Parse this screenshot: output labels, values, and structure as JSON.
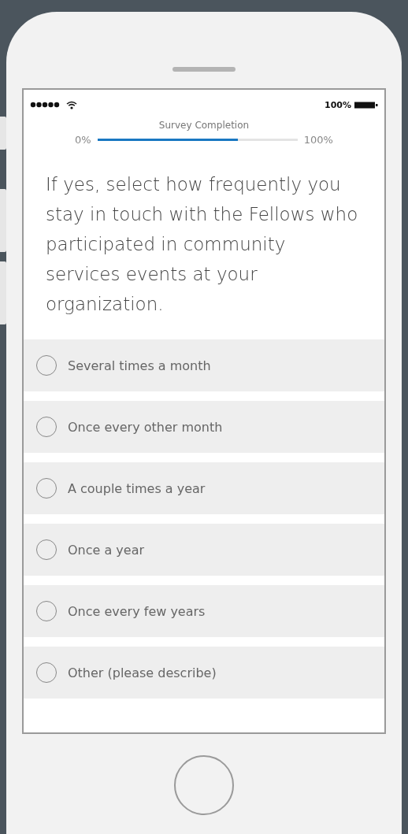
{
  "status_bar": {
    "battery_text": "100%"
  },
  "progress": {
    "title": "Survey Completion",
    "start_label": "0%",
    "end_label": "100%",
    "level": 0.7
  },
  "question": "If yes, select how frequently you stay in touch with the Fellows who participated in community services events at your organization.",
  "options": [
    {
      "label": "Several times a month",
      "selected": false
    },
    {
      "label": "Once every other month",
      "selected": false
    },
    {
      "label": "A couple times a year",
      "selected": false
    },
    {
      "label": "Once a year",
      "selected": false
    },
    {
      "label": "Once every few years",
      "selected": false
    },
    {
      "label": "Other (please describe)",
      "selected": false
    }
  ]
}
